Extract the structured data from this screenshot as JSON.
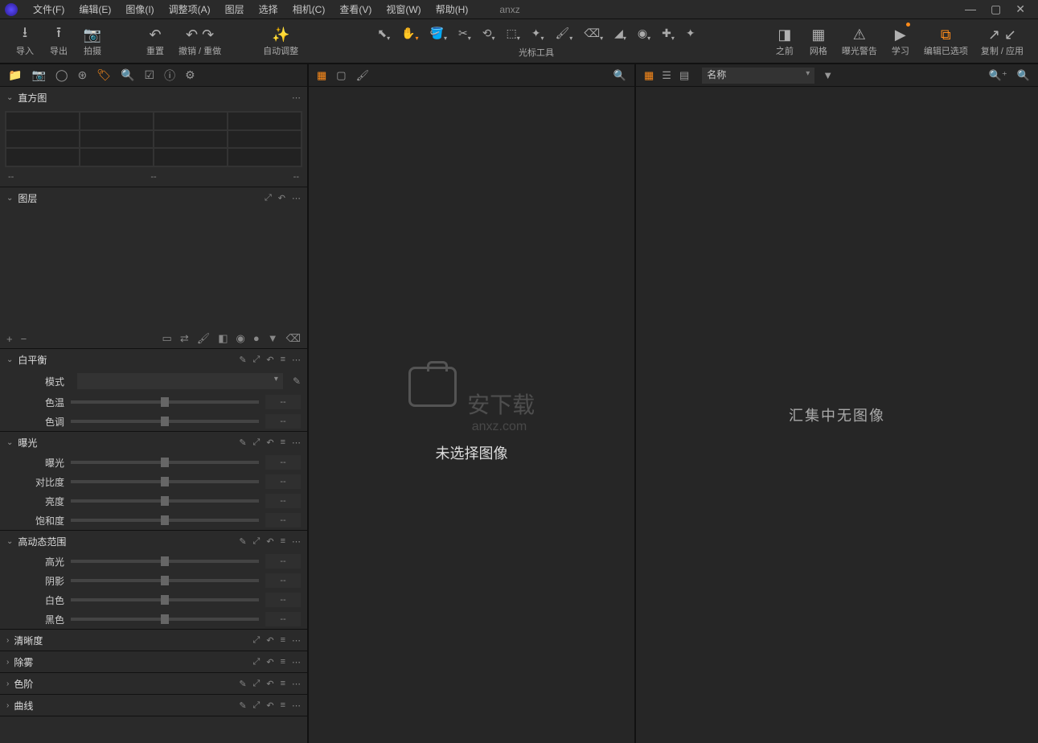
{
  "menubar": {
    "items": [
      "文件(F)",
      "编辑(E)",
      "图像(I)",
      "调整项(A)",
      "图层",
      "选择",
      "相机(C)",
      "查看(V)",
      "视窗(W)",
      "帮助(H)"
    ],
    "doc_title": "anxz"
  },
  "toolbar": {
    "import": "导入",
    "export": "导出",
    "capture": "拍摄",
    "reset": "重置",
    "undo_redo": "撤销 / 重做",
    "auto_adjust": "自动调整",
    "cursor_label": "光标工具",
    "before": "之前",
    "grid": "网格",
    "exposure_warning": "曝光警告",
    "learn": "学习",
    "edit_selected": "编辑已选项",
    "copy_apply": "复制 / 应用"
  },
  "left_tabs": [
    "folder",
    "camera",
    "circle",
    "venn",
    "tag",
    "search",
    "check",
    "info",
    "gear"
  ],
  "panels": {
    "histogram": {
      "title": "直方图",
      "v1": "--",
      "v2": "--",
      "v3": "--"
    },
    "layers": {
      "title": "图层"
    },
    "white_balance": {
      "title": "白平衡",
      "mode_label": "模式",
      "rows": [
        {
          "label": "色温",
          "value": "--"
        },
        {
          "label": "色调",
          "value": "--"
        }
      ]
    },
    "exposure": {
      "title": "曝光",
      "rows": [
        {
          "label": "曝光",
          "value": "--"
        },
        {
          "label": "对比度",
          "value": "--"
        },
        {
          "label": "亮度",
          "value": "--"
        },
        {
          "label": "饱和度",
          "value": "--"
        }
      ]
    },
    "hdr": {
      "title": "高动态范围",
      "rows": [
        {
          "label": "高光",
          "value": "--"
        },
        {
          "label": "阴影",
          "value": "--"
        },
        {
          "label": "白色",
          "value": "--"
        },
        {
          "label": "黑色",
          "value": "--"
        }
      ]
    },
    "clarity": {
      "title": "清晰度"
    },
    "dehaze": {
      "title": "除雾"
    },
    "levels": {
      "title": "色阶"
    },
    "curves": {
      "title": "曲线"
    }
  },
  "viewer": {
    "watermark_main": "安下载",
    "watermark_sub": "anxz.com",
    "message": "未选择图像"
  },
  "browser": {
    "sort_label": "名称",
    "message": "汇集中无图像"
  }
}
